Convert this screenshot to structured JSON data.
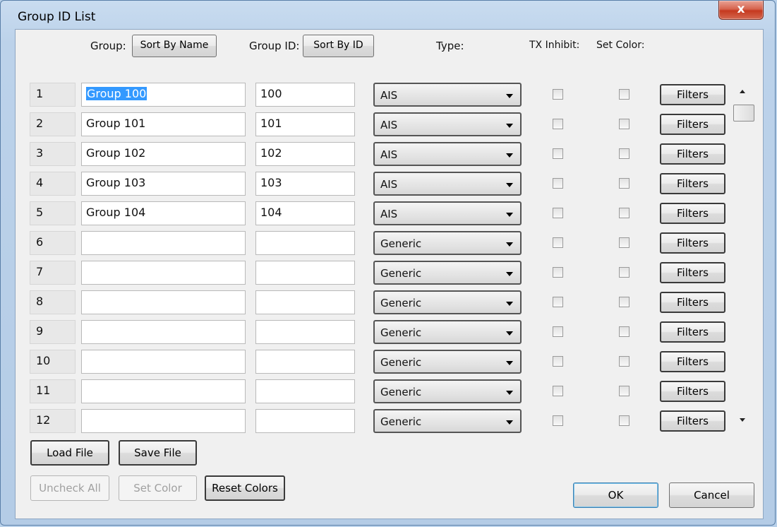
{
  "window": {
    "title": "Group ID List",
    "close_label": "x"
  },
  "headers": {
    "group_label": "Group:",
    "sort_by_name": "Sort By Name",
    "group_id_label": "Group ID:",
    "sort_by_id": "Sort By ID",
    "type_label": "Type:",
    "tx_inhibit_label": "TX Inhibit:",
    "set_color_label": "Set Color:"
  },
  "rows": [
    {
      "num": "1",
      "name": "Group 100",
      "id": "100",
      "type": "AIS",
      "tx_inhibit": false,
      "set_color": false,
      "filters": "Filters"
    },
    {
      "num": "2",
      "name": "Group 101",
      "id": "101",
      "type": "AIS",
      "tx_inhibit": false,
      "set_color": false,
      "filters": "Filters"
    },
    {
      "num": "3",
      "name": "Group 102",
      "id": "102",
      "type": "AIS",
      "tx_inhibit": false,
      "set_color": false,
      "filters": "Filters"
    },
    {
      "num": "4",
      "name": "Group 103",
      "id": "103",
      "type": "AIS",
      "tx_inhibit": false,
      "set_color": false,
      "filters": "Filters"
    },
    {
      "num": "5",
      "name": "Group 104",
      "id": "104",
      "type": "AIS",
      "tx_inhibit": false,
      "set_color": false,
      "filters": "Filters"
    },
    {
      "num": "6",
      "name": "",
      "id": "",
      "type": "Generic",
      "tx_inhibit": false,
      "set_color": false,
      "filters": "Filters"
    },
    {
      "num": "7",
      "name": "",
      "id": "",
      "type": "Generic",
      "tx_inhibit": false,
      "set_color": false,
      "filters": "Filters"
    },
    {
      "num": "8",
      "name": "",
      "id": "",
      "type": "Generic",
      "tx_inhibit": false,
      "set_color": false,
      "filters": "Filters"
    },
    {
      "num": "9",
      "name": "",
      "id": "",
      "type": "Generic",
      "tx_inhibit": false,
      "set_color": false,
      "filters": "Filters"
    },
    {
      "num": "10",
      "name": "",
      "id": "",
      "type": "Generic",
      "tx_inhibit": false,
      "set_color": false,
      "filters": "Filters"
    },
    {
      "num": "11",
      "name": "",
      "id": "",
      "type": "Generic",
      "tx_inhibit": false,
      "set_color": false,
      "filters": "Filters"
    },
    {
      "num": "12",
      "name": "",
      "id": "",
      "type": "Generic",
      "tx_inhibit": false,
      "set_color": false,
      "filters": "Filters"
    }
  ],
  "buttons": {
    "load_file": "Load File",
    "save_file": "Save File",
    "uncheck_all": "Uncheck All",
    "set_color": "Set Color",
    "reset_colors": "Reset Colors",
    "ok": "OK",
    "cancel": "Cancel"
  },
  "colors": {
    "title_bar": "#c9dcf0",
    "close_button": "#c5391f",
    "selection": "#3399ff"
  }
}
